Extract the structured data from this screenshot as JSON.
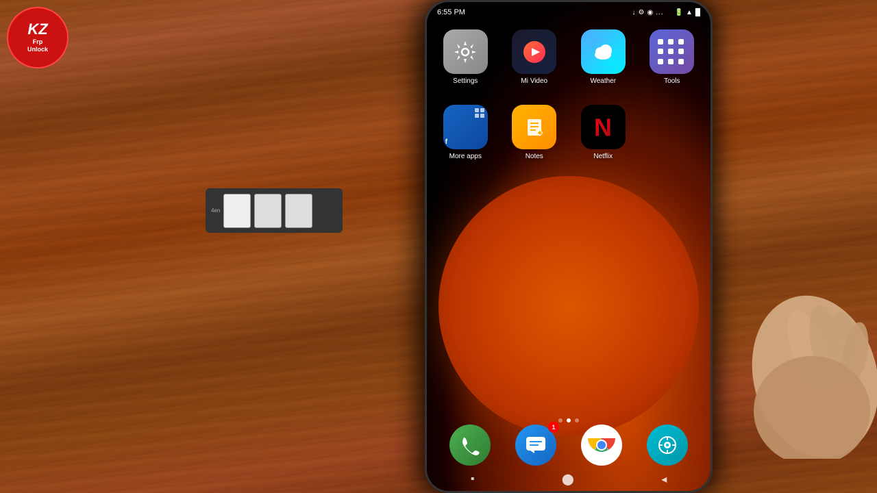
{
  "logo": {
    "initials": "KZ",
    "line1": "Frp",
    "line2": "Unlock"
  },
  "status_bar": {
    "time": "6:55 PM",
    "dots": "...",
    "battery": "███",
    "wifi": "WiFi",
    "signal": "Signal"
  },
  "row1_apps": [
    {
      "id": "settings",
      "label": "Settings",
      "icon_type": "settings"
    },
    {
      "id": "mi-video",
      "label": "Mi Video",
      "icon_type": "mivideo"
    },
    {
      "id": "weather",
      "label": "Weather",
      "icon_type": "weather"
    },
    {
      "id": "tools",
      "label": "Tools",
      "icon_type": "tools"
    }
  ],
  "row2_apps": [
    {
      "id": "more-apps",
      "label": "More apps",
      "icon_type": "moreapps"
    },
    {
      "id": "notes",
      "label": "Notes",
      "icon_type": "notes"
    },
    {
      "id": "netflix",
      "label": "Netflix",
      "icon_type": "netflix"
    },
    {
      "id": "empty",
      "label": "",
      "icon_type": "empty"
    }
  ],
  "dock_apps": [
    {
      "id": "phone",
      "label": "Phone",
      "icon_type": "phone",
      "badge": null
    },
    {
      "id": "messages",
      "label": "Messages",
      "icon_type": "messages",
      "badge": "1"
    },
    {
      "id": "chrome",
      "label": "Chrome",
      "icon_type": "chrome",
      "badge": null
    },
    {
      "id": "security",
      "label": "Security",
      "icon_type": "security",
      "badge": null
    }
  ],
  "page_indicators": {
    "total": 3,
    "active": 1
  },
  "nav_buttons": [
    "▪",
    "⬤",
    "◂"
  ],
  "sim_tray_label": "4en"
}
